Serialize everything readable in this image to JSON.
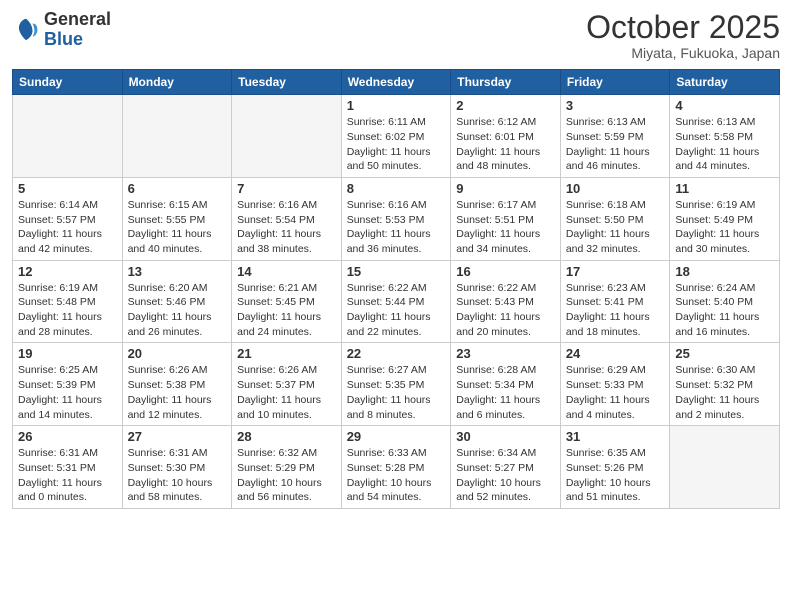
{
  "header": {
    "logo_general": "General",
    "logo_blue": "Blue",
    "month": "October 2025",
    "location": "Miyata, Fukuoka, Japan"
  },
  "weekdays": [
    "Sunday",
    "Monday",
    "Tuesday",
    "Wednesday",
    "Thursday",
    "Friday",
    "Saturday"
  ],
  "weeks": [
    [
      {
        "day": "",
        "info": ""
      },
      {
        "day": "",
        "info": ""
      },
      {
        "day": "",
        "info": ""
      },
      {
        "day": "1",
        "info": "Sunrise: 6:11 AM\nSunset: 6:02 PM\nDaylight: 11 hours\nand 50 minutes."
      },
      {
        "day": "2",
        "info": "Sunrise: 6:12 AM\nSunset: 6:01 PM\nDaylight: 11 hours\nand 48 minutes."
      },
      {
        "day": "3",
        "info": "Sunrise: 6:13 AM\nSunset: 5:59 PM\nDaylight: 11 hours\nand 46 minutes."
      },
      {
        "day": "4",
        "info": "Sunrise: 6:13 AM\nSunset: 5:58 PM\nDaylight: 11 hours\nand 44 minutes."
      }
    ],
    [
      {
        "day": "5",
        "info": "Sunrise: 6:14 AM\nSunset: 5:57 PM\nDaylight: 11 hours\nand 42 minutes."
      },
      {
        "day": "6",
        "info": "Sunrise: 6:15 AM\nSunset: 5:55 PM\nDaylight: 11 hours\nand 40 minutes."
      },
      {
        "day": "7",
        "info": "Sunrise: 6:16 AM\nSunset: 5:54 PM\nDaylight: 11 hours\nand 38 minutes."
      },
      {
        "day": "8",
        "info": "Sunrise: 6:16 AM\nSunset: 5:53 PM\nDaylight: 11 hours\nand 36 minutes."
      },
      {
        "day": "9",
        "info": "Sunrise: 6:17 AM\nSunset: 5:51 PM\nDaylight: 11 hours\nand 34 minutes."
      },
      {
        "day": "10",
        "info": "Sunrise: 6:18 AM\nSunset: 5:50 PM\nDaylight: 11 hours\nand 32 minutes."
      },
      {
        "day": "11",
        "info": "Sunrise: 6:19 AM\nSunset: 5:49 PM\nDaylight: 11 hours\nand 30 minutes."
      }
    ],
    [
      {
        "day": "12",
        "info": "Sunrise: 6:19 AM\nSunset: 5:48 PM\nDaylight: 11 hours\nand 28 minutes."
      },
      {
        "day": "13",
        "info": "Sunrise: 6:20 AM\nSunset: 5:46 PM\nDaylight: 11 hours\nand 26 minutes."
      },
      {
        "day": "14",
        "info": "Sunrise: 6:21 AM\nSunset: 5:45 PM\nDaylight: 11 hours\nand 24 minutes."
      },
      {
        "day": "15",
        "info": "Sunrise: 6:22 AM\nSunset: 5:44 PM\nDaylight: 11 hours\nand 22 minutes."
      },
      {
        "day": "16",
        "info": "Sunrise: 6:22 AM\nSunset: 5:43 PM\nDaylight: 11 hours\nand 20 minutes."
      },
      {
        "day": "17",
        "info": "Sunrise: 6:23 AM\nSunset: 5:41 PM\nDaylight: 11 hours\nand 18 minutes."
      },
      {
        "day": "18",
        "info": "Sunrise: 6:24 AM\nSunset: 5:40 PM\nDaylight: 11 hours\nand 16 minutes."
      }
    ],
    [
      {
        "day": "19",
        "info": "Sunrise: 6:25 AM\nSunset: 5:39 PM\nDaylight: 11 hours\nand 14 minutes."
      },
      {
        "day": "20",
        "info": "Sunrise: 6:26 AM\nSunset: 5:38 PM\nDaylight: 11 hours\nand 12 minutes."
      },
      {
        "day": "21",
        "info": "Sunrise: 6:26 AM\nSunset: 5:37 PM\nDaylight: 11 hours\nand 10 minutes."
      },
      {
        "day": "22",
        "info": "Sunrise: 6:27 AM\nSunset: 5:35 PM\nDaylight: 11 hours\nand 8 minutes."
      },
      {
        "day": "23",
        "info": "Sunrise: 6:28 AM\nSunset: 5:34 PM\nDaylight: 11 hours\nand 6 minutes."
      },
      {
        "day": "24",
        "info": "Sunrise: 6:29 AM\nSunset: 5:33 PM\nDaylight: 11 hours\nand 4 minutes."
      },
      {
        "day": "25",
        "info": "Sunrise: 6:30 AM\nSunset: 5:32 PM\nDaylight: 11 hours\nand 2 minutes."
      }
    ],
    [
      {
        "day": "26",
        "info": "Sunrise: 6:31 AM\nSunset: 5:31 PM\nDaylight: 11 hours\nand 0 minutes."
      },
      {
        "day": "27",
        "info": "Sunrise: 6:31 AM\nSunset: 5:30 PM\nDaylight: 10 hours\nand 58 minutes."
      },
      {
        "day": "28",
        "info": "Sunrise: 6:32 AM\nSunset: 5:29 PM\nDaylight: 10 hours\nand 56 minutes."
      },
      {
        "day": "29",
        "info": "Sunrise: 6:33 AM\nSunset: 5:28 PM\nDaylight: 10 hours\nand 54 minutes."
      },
      {
        "day": "30",
        "info": "Sunrise: 6:34 AM\nSunset: 5:27 PM\nDaylight: 10 hours\nand 52 minutes."
      },
      {
        "day": "31",
        "info": "Sunrise: 6:35 AM\nSunset: 5:26 PM\nDaylight: 10 hours\nand 51 minutes."
      },
      {
        "day": "",
        "info": ""
      }
    ]
  ]
}
